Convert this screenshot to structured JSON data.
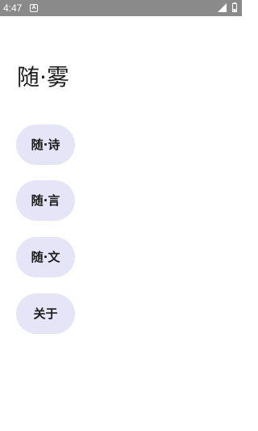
{
  "status_bar": {
    "time": "4:47",
    "notification_letter": "A",
    "background_color": "#8a8a8a"
  },
  "app": {
    "title": "随·雾"
  },
  "menu": {
    "items": [
      {
        "label": "随·诗"
      },
      {
        "label": "随·言"
      },
      {
        "label": "随·文"
      },
      {
        "label": "关于"
      }
    ],
    "button_color": "#e6e5f8"
  }
}
